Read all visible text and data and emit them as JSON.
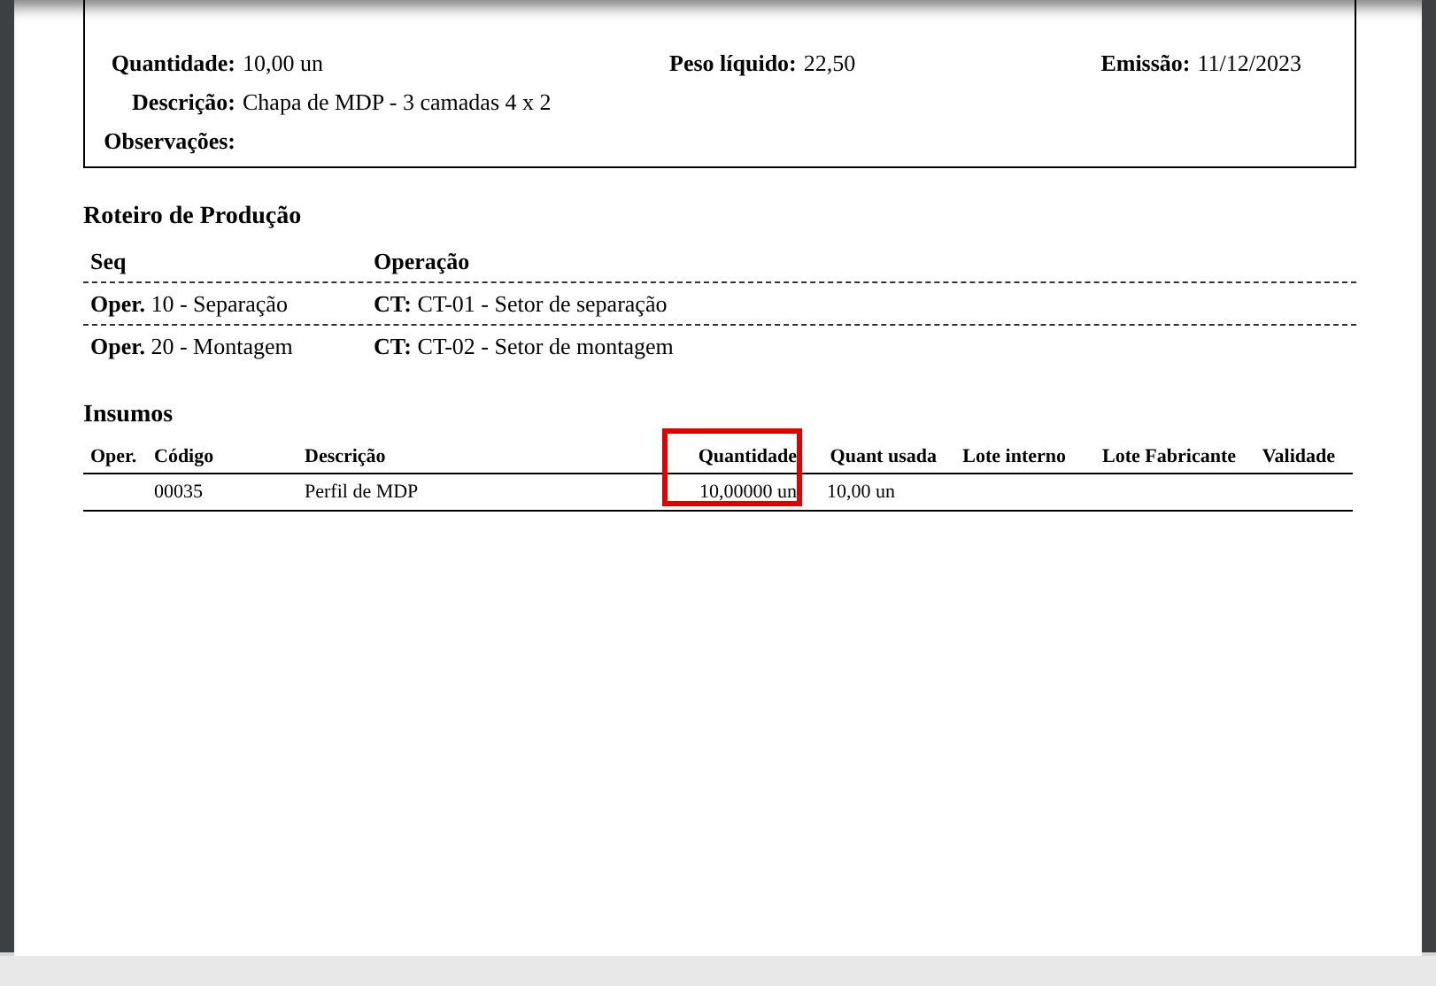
{
  "header_box": {
    "rows": [
      {
        "fields": [
          {
            "label": "Quantidade:",
            "value": "10,00 un"
          },
          {
            "label": "Peso líquido:",
            "value": "22,50"
          },
          {
            "label": "Emissão:",
            "value": "11/12/2023"
          }
        ]
      },
      {
        "fields": [
          {
            "label": "Descrição:",
            "value": "Chapa de MDP - 3 camadas 4 x 2"
          }
        ]
      },
      {
        "fields": [
          {
            "label": "Observações:"
          }
        ]
      }
    ]
  },
  "routing": {
    "title": "Roteiro de Produção",
    "columns": [
      "Seq",
      "Operação"
    ],
    "rows": [
      {
        "seq_label": "Oper.",
        "seq": "10 - Separação",
        "op_label": "CT:",
        "op": "CT-01 - Setor de separação"
      },
      {
        "seq_label": "Oper.",
        "seq": "20 - Montagem",
        "op_label": "CT:",
        "op": "CT-02 - Setor de montagem"
      }
    ]
  },
  "inputs": {
    "title": "Insumos",
    "columns": [
      {
        "label": "Oper.",
        "highlighted": false
      },
      {
        "label": "Código",
        "highlighted": false
      },
      {
        "label": "Descrição",
        "highlighted": false
      },
      {
        "label": "Quantidade",
        "highlighted": true
      },
      {
        "label": "Quant usada",
        "highlighted": false
      },
      {
        "label": "Lote interno",
        "highlighted": false
      },
      {
        "label": "Lote Fabricante",
        "highlighted": false
      },
      {
        "label": "Validade",
        "highlighted": false
      }
    ],
    "rows": [
      [
        "",
        "00035",
        "Perfil de MDP",
        "10,00000  un",
        "10,00 un",
        "",
        "",
        ""
      ]
    ]
  }
}
